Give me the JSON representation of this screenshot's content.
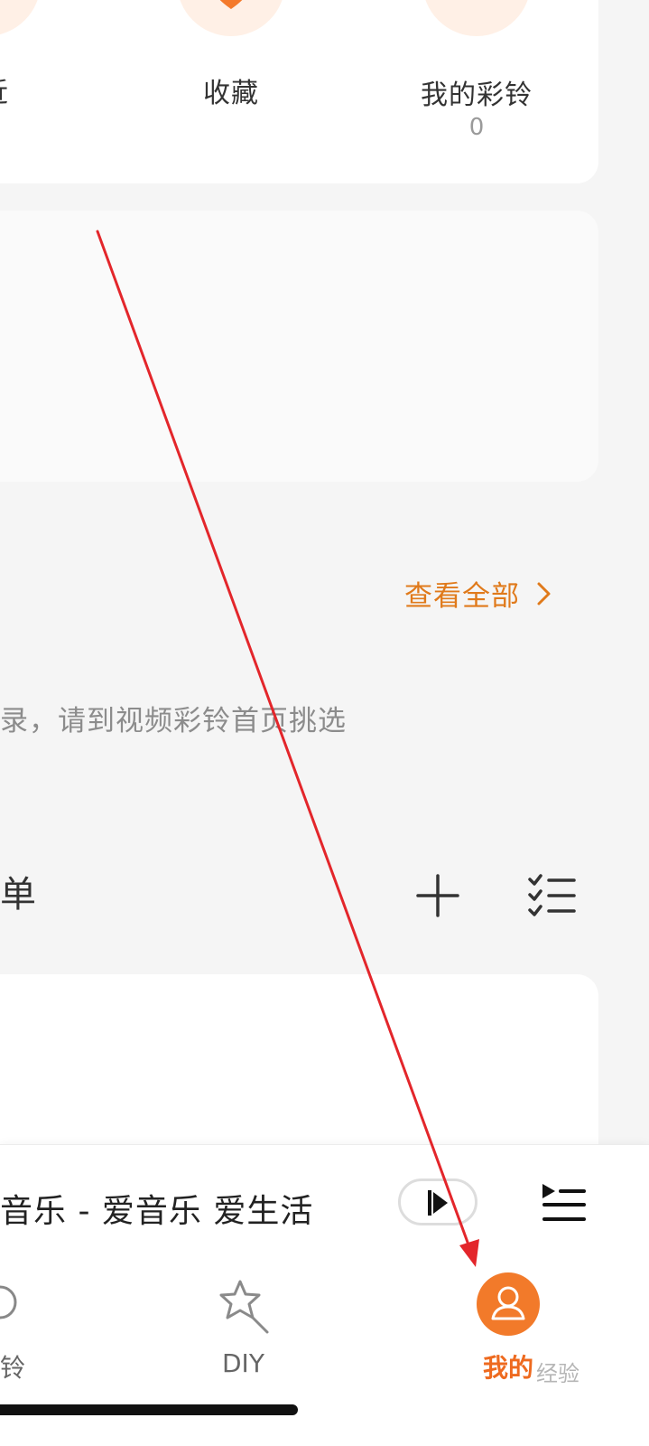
{
  "quick_access": [
    {
      "label": "近",
      "icon": "clock-icon"
    },
    {
      "label": "收藏",
      "icon": "heart-icon"
    },
    {
      "label": "我的彩铃",
      "count": "0",
      "icon": "bell-icon"
    }
  ],
  "video_ringtone": {
    "view_all": "查看全部",
    "empty_hint": "录，请到视频彩铃首页挑选"
  },
  "playlist_section": {
    "title": "单",
    "add_icon": "plus-icon",
    "manage_icon": "checklist-icon"
  },
  "player": {
    "now_playing": "音乐 - 爱音乐  爱生活",
    "play_icon": "play-icon",
    "queue_icon": "playlist-queue-icon"
  },
  "bottom_nav": [
    {
      "label": "铃",
      "icon": "ring-icon"
    },
    {
      "label": "DIY",
      "icon": "star-wand-icon"
    },
    {
      "label": "我的",
      "icon": "user-avatar-icon",
      "active": true
    }
  ],
  "watermark": "经验",
  "colors": {
    "accent": "#ee6a1f",
    "link": "#e07a1b",
    "annotation": "#e3262b"
  }
}
